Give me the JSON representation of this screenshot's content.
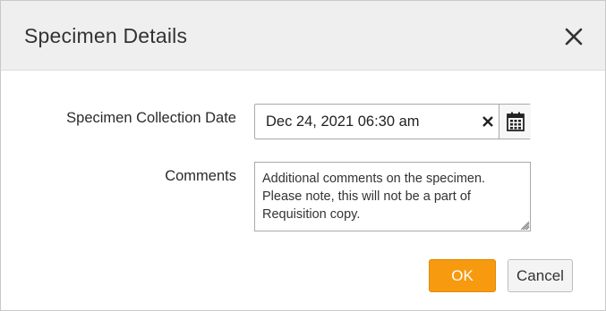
{
  "dialog": {
    "title": "Specimen Details",
    "close_icon": "close-icon"
  },
  "form": {
    "collection_date": {
      "label": "Specimen Collection Date",
      "value": "Dec 24, 2021 06:30 am",
      "clear_icon": "clear-icon",
      "calendar_icon": "calendar-icon"
    },
    "comments": {
      "label": "Comments",
      "placeholder": "Additional comments on the specimen. Please note, this will not be a part of Requisition copy."
    }
  },
  "footer": {
    "ok_label": "OK",
    "cancel_label": "Cancel"
  },
  "colors": {
    "primary_button": "#f79a0f",
    "header_bg": "#efefef"
  }
}
